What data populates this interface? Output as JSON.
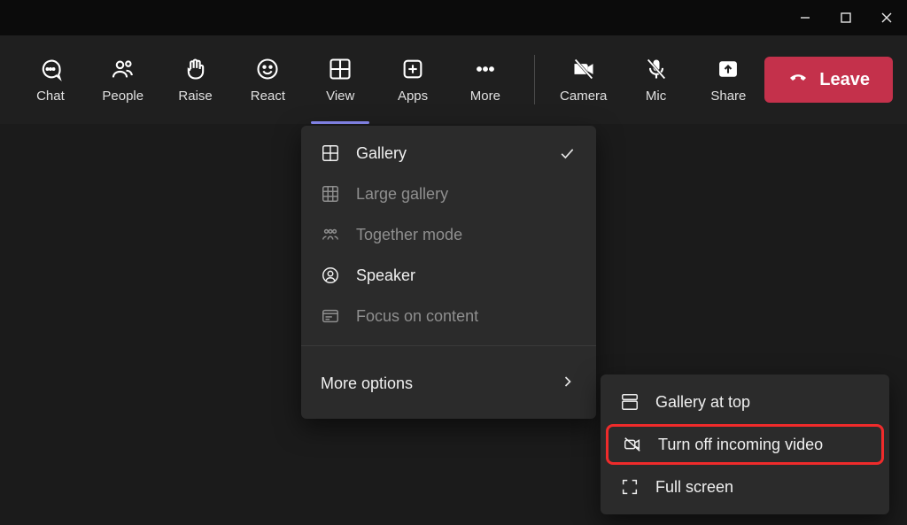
{
  "toolbar": {
    "chat": {
      "label": "Chat"
    },
    "people": {
      "label": "People"
    },
    "raise": {
      "label": "Raise"
    },
    "react": {
      "label": "React"
    },
    "view": {
      "label": "View"
    },
    "apps": {
      "label": "Apps"
    },
    "more": {
      "label": "More"
    },
    "camera": {
      "label": "Camera"
    },
    "mic": {
      "label": "Mic"
    },
    "share": {
      "label": "Share"
    },
    "leave": {
      "label": "Leave"
    }
  },
  "view_menu": {
    "gallery": {
      "label": "Gallery"
    },
    "large_gallery": {
      "label": "Large gallery"
    },
    "together": {
      "label": "Together mode"
    },
    "speaker": {
      "label": "Speaker"
    },
    "focus": {
      "label": "Focus on content"
    },
    "more_options": {
      "label": "More options"
    }
  },
  "sub_menu": {
    "gallery_top": {
      "label": "Gallery at top"
    },
    "turn_off_vid": {
      "label": "Turn off incoming video"
    },
    "full_screen": {
      "label": "Full screen"
    }
  },
  "colors": {
    "accent": "#8b8cf7",
    "danger": "#c4314b",
    "highlight": "#ef2b2b"
  }
}
